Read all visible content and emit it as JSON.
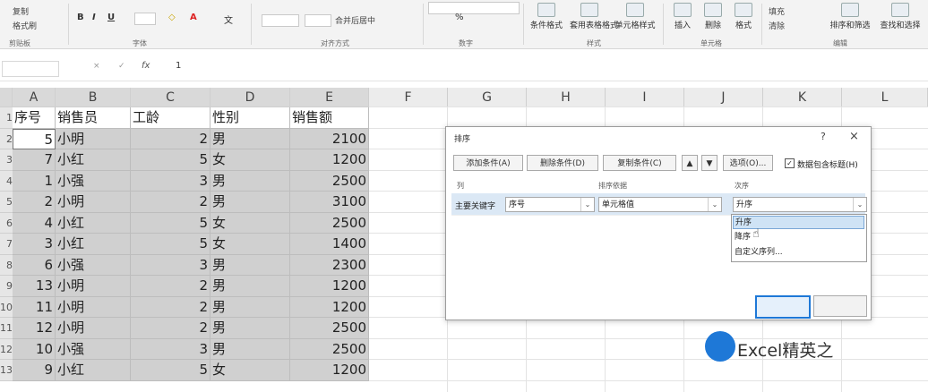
{
  "ribbon": {
    "clipboard": {
      "painter": "格式刷",
      "paste_small": "复制",
      "group": "剪贴板"
    },
    "font": {
      "group": "字体",
      "bold": "B",
      "italic": "I",
      "underline": "U",
      "font_color": "A",
      "wen": "文"
    },
    "alignment": {
      "group": "对齐方式",
      "merge": "合并后居中"
    },
    "number": {
      "group": "数字",
      "percent": "%"
    },
    "styles": {
      "group": "样式",
      "cond_format": "条件格式",
      "table_format": "套用表格格式",
      "cell_styles": "单元格样式"
    },
    "cells": {
      "group": "单元格",
      "insert": "插入",
      "delete": "删除",
      "format": "格式"
    },
    "editing": {
      "group": "编辑",
      "fill": "填充",
      "clear": "清除",
      "sort_filter": "排序和筛选",
      "find": "查找和选择"
    }
  },
  "formula_bar": {
    "fx": "fx",
    "value": "1"
  },
  "columns": [
    "A",
    "B",
    "C",
    "D",
    "E",
    "F",
    "G",
    "H",
    "I",
    "J",
    "K",
    "L"
  ],
  "rows": [
    "1",
    "2",
    "3",
    "4",
    "5",
    "6",
    "7",
    "8",
    "9",
    "10",
    "11",
    "12",
    "13"
  ],
  "table": {
    "headers": [
      "序号",
      "销售员",
      "工龄",
      "性别",
      "销售额"
    ],
    "data": [
      [
        "5",
        "小明",
        "2",
        "男",
        "2100"
      ],
      [
        "7",
        "小红",
        "5",
        "女",
        "1200"
      ],
      [
        "1",
        "小强",
        "3",
        "男",
        "2500"
      ],
      [
        "2",
        "小明",
        "2",
        "男",
        "3100"
      ],
      [
        "4",
        "小红",
        "5",
        "女",
        "2500"
      ],
      [
        "3",
        "小红",
        "5",
        "女",
        "1400"
      ],
      [
        "6",
        "小强",
        "3",
        "男",
        "2300"
      ],
      [
        "13",
        "小明",
        "2",
        "男",
        "1200"
      ],
      [
        "11",
        "小明",
        "2",
        "男",
        "1200"
      ],
      [
        "12",
        "小明",
        "2",
        "男",
        "2500"
      ],
      [
        "10",
        "小强",
        "3",
        "男",
        "2500"
      ],
      [
        "9",
        "小红",
        "5",
        "女",
        "1200"
      ]
    ]
  },
  "dialog": {
    "title": "排序",
    "help": "?",
    "close": "×",
    "add_level": "添加条件(A)",
    "delete_level": "删除条件(D)",
    "copy_level": "复制条件(C)",
    "up": "▲",
    "down": "▼",
    "options": "选项(O)...",
    "has_headers": "数据包含标题(H)",
    "col_header": "列",
    "sort_on_header": "排序依据",
    "order_header": "次序",
    "row_label": "主要关键字",
    "key_value": "序号",
    "sort_on_value": "单元格值",
    "order_value": "升序",
    "dropdown": [
      "升序",
      "降序",
      "自定义序列..."
    ]
  },
  "watermark": {
    "text": "Excel精英之"
  },
  "colors": {
    "selection": "#d0d0d0",
    "highlight": "#cfe3f5",
    "accent": "#1e78d7"
  }
}
